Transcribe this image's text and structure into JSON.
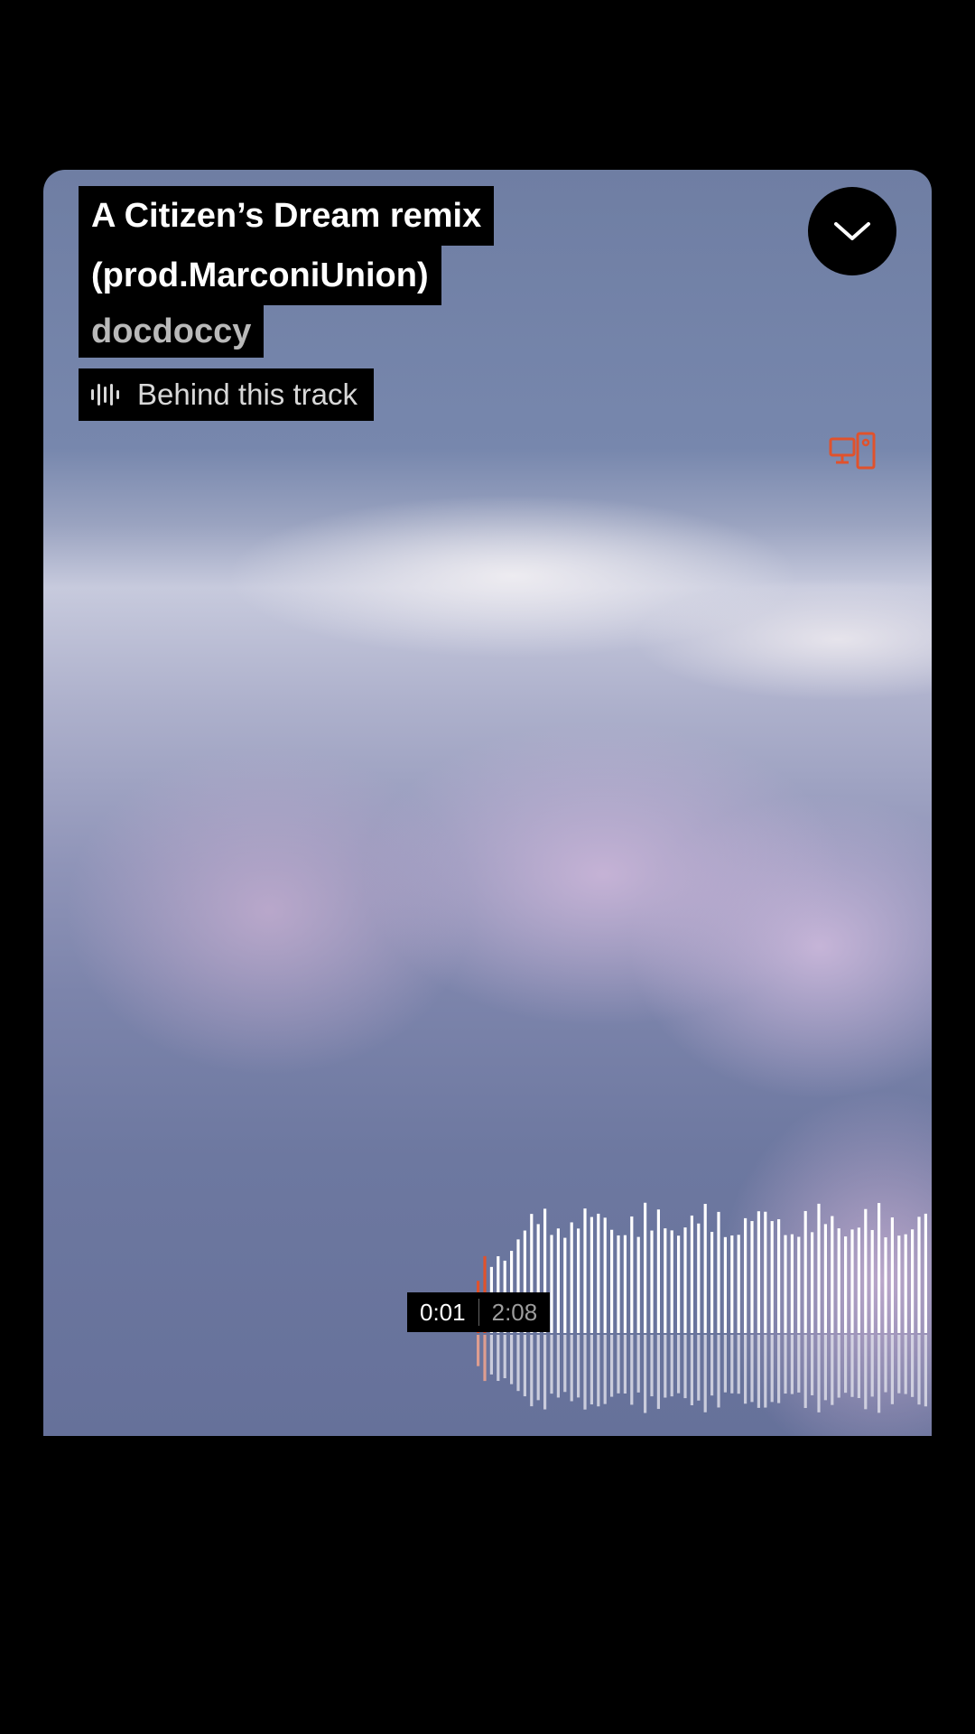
{
  "track": {
    "title_line1": "A Citizen’s Dream remix",
    "title_line2": "(prod.MarconiUnion)",
    "artist": "docdoccy",
    "behind_label": "Behind this track"
  },
  "player": {
    "current_time": "0:01",
    "duration": "2:08",
    "progress": 0.008
  },
  "icons": {
    "collapse": "chevron-down-icon",
    "behind": "waveform-icon",
    "cast": "cast-devices-icon"
  },
  "colors": {
    "accent": "#e0522c",
    "played_bar": "#e0522c",
    "unplayed_bar": "#ffffff"
  }
}
